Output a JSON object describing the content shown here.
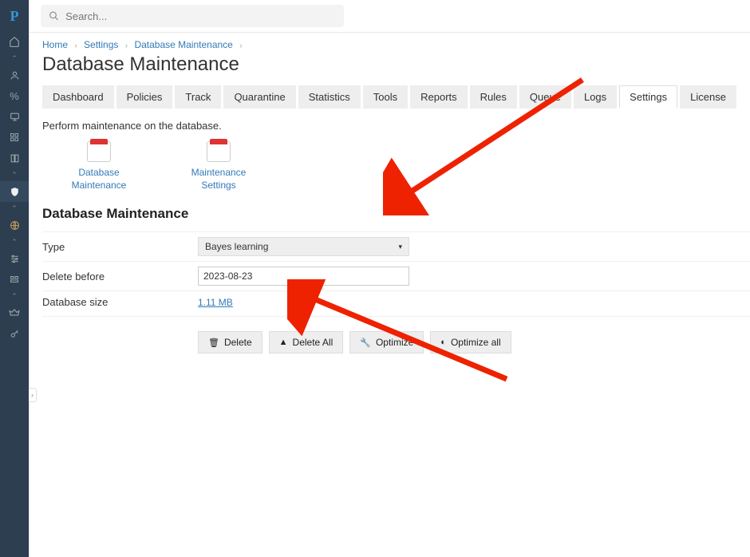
{
  "search": {
    "placeholder": "Search..."
  },
  "breadcrumb": {
    "home": "Home",
    "settings": "Settings",
    "dbm": "Database Maintenance"
  },
  "page_title": "Database Maintenance",
  "tabs": {
    "dashboard": "Dashboard",
    "policies": "Policies",
    "track": "Track",
    "quarantine": "Quarantine",
    "statistics": "Statistics",
    "tools": "Tools",
    "reports": "Reports",
    "rules": "Rules",
    "queue": "Queue",
    "logs": "Logs",
    "settings": "Settings",
    "license": "License"
  },
  "intro": "Perform maintenance on the database.",
  "tiles": {
    "dbm": "Database Maintenance",
    "msettings": "Maintenance Settings"
  },
  "section_title": "Database Maintenance",
  "form": {
    "type_label": "Type",
    "type_value": "Bayes learning",
    "delete_before_label": "Delete before",
    "delete_before_value": "2023-08-23",
    "db_size_label": "Database size",
    "db_size_value": "1.11 MB"
  },
  "buttons": {
    "delete": "Delete",
    "delete_all": "Delete All",
    "optimize": "Optimize",
    "optimize_all": "Optimize all"
  },
  "logo": "P"
}
